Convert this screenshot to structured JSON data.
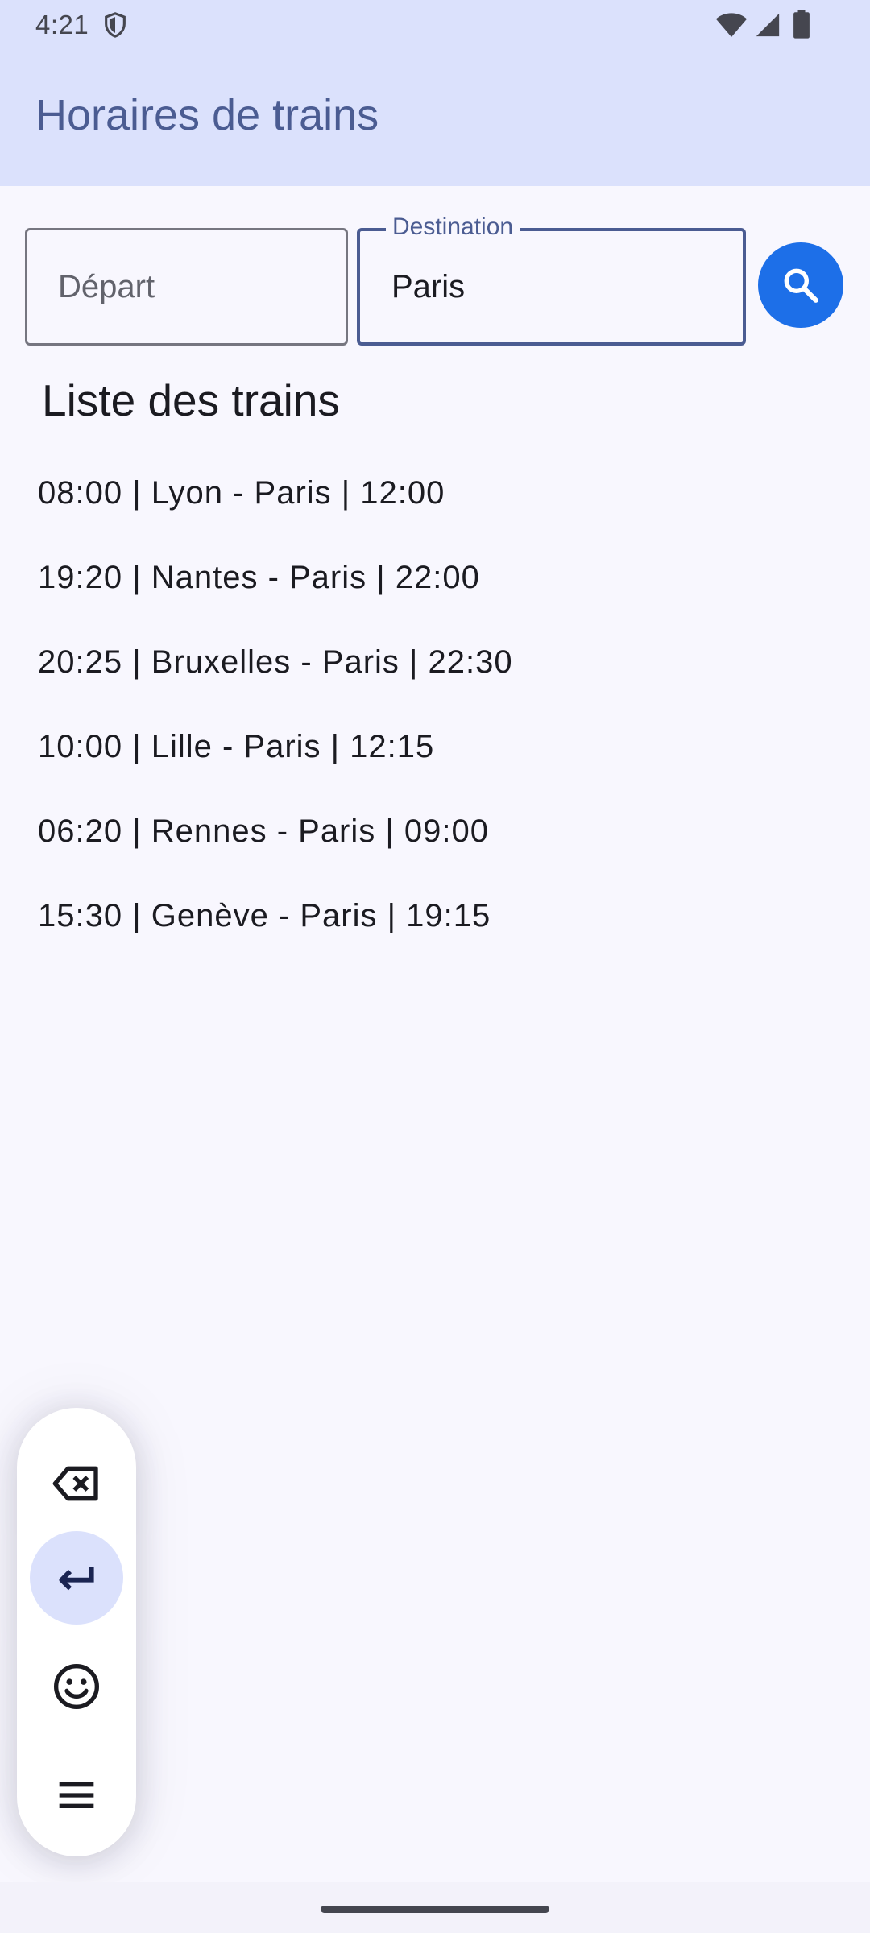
{
  "status_bar": {
    "time": "4:21",
    "icons": [
      "shield-icon",
      "wifi-icon",
      "signal-icon",
      "battery-icon"
    ]
  },
  "app": {
    "title": "Horaires de trains"
  },
  "search": {
    "depart_placeholder": "Départ",
    "destination_label": "Destination",
    "destination_value": "Paris",
    "button_icon": "search-icon"
  },
  "list": {
    "title": "Liste des trains",
    "items": [
      "08:00 | Lyon - Paris | 12:00",
      "19:20 | Nantes - Paris | 22:00",
      "20:25 | Bruxelles - Paris | 22:30",
      "10:00 | Lille - Paris | 12:15",
      "06:20 | Rennes - Paris | 09:00",
      "15:30 | Genève - Paris | 19:15"
    ]
  },
  "keyboard_panel": {
    "keys": [
      "backspace-icon",
      "enter-icon",
      "emoji-icon",
      "menu-icon"
    ]
  },
  "colors": {
    "appbar_bg": "#dbe1fc",
    "title": "#4b5c92",
    "accent_button": "#1d6fe8",
    "background": "#f8f7fe"
  }
}
